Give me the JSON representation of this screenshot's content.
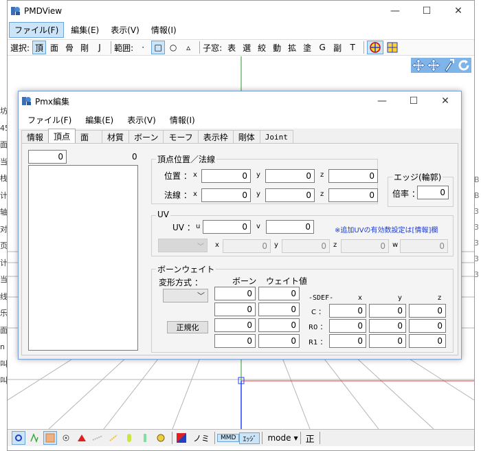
{
  "bg_strip_left": [
    "坊",
    "45",
    "面",
    "当",
    "栈",
    "计",
    "轴",
    "对",
    "页",
    "计",
    "当",
    "线",
    "乐",
    "面",
    "n",
    "叫",
    "叫"
  ],
  "bg_strip_right": [
    "B",
    "B",
    "3",
    "3",
    "3",
    "3",
    "3"
  ],
  "main": {
    "title": "PMDView",
    "menu": [
      "ファイル(F)",
      "編集(E)",
      "表示(V)",
      "情報(I)"
    ],
    "toolbar": {
      "select_label": "選択:",
      "select_buttons": [
        "頂",
        "面",
        "骨",
        "剛",
        "J"
      ],
      "range_label": "範囲:",
      "range_buttons": [
        "·",
        "□",
        "○",
        "▵"
      ],
      "child_label": "子窓:",
      "child_buttons": [
        "表",
        "選",
        "絞",
        "動",
        "拡",
        "塗",
        "G",
        "副",
        "T"
      ]
    },
    "status": {
      "nomi": "ノミ",
      "mmd": "MMD",
      "edge": "ｴｯｼﾞ",
      "mode": "mode",
      "sei": "正"
    }
  },
  "pmx": {
    "title": "Pmx編集",
    "menu": [
      "ファイル(F)",
      "編集(E)",
      "表示(V)",
      "情報(I)"
    ],
    "tabs": [
      "情報",
      "頂点",
      "面",
      "材質",
      "ボーン",
      "モーフ",
      "表示枠",
      "剛体",
      "Joint"
    ],
    "active_tab": "頂点",
    "vertex_index": "0",
    "vertex_count": "0",
    "pos_group": {
      "title": "頂点位置／法線",
      "position_label": "位置 ：",
      "normal_label": "法線 ：",
      "ax": [
        "x",
        "y",
        "z"
      ],
      "position": [
        "0",
        "0",
        "0"
      ],
      "normal": [
        "0",
        "0",
        "0"
      ]
    },
    "edge_group": {
      "title": "エッジ(輪郭)",
      "scale_label": "倍率 ：",
      "scale": "0"
    },
    "uv_group": {
      "title": "UV",
      "uv_label": "UV ：",
      "u_label": "u",
      "v_label": "v",
      "u": "0",
      "v": "0",
      "note": "※追加UVの有効数設定は[情報]欄",
      "ext_labels": [
        "x",
        "y",
        "z",
        "w"
      ],
      "ext": [
        "0",
        "0",
        "0",
        "0"
      ]
    },
    "weight_group": {
      "title": "ボーンウェイト",
      "deform_label": "変形方式 ：",
      "bone_header": "ボーン",
      "weight_header": "ウェイト値",
      "normalize_btn": "正規化",
      "bones": [
        "0",
        "0",
        "0",
        "0"
      ],
      "weights": [
        "0",
        "0",
        "0",
        "0"
      ],
      "sdef": {
        "header": "-SDEF-",
        "cols": [
          "x",
          "y",
          "z"
        ],
        "rows": [
          {
            "label": "C ：",
            "vals": [
              "0",
              "0",
              "0"
            ]
          },
          {
            "label": "R0 ：",
            "vals": [
              "0",
              "0",
              "0"
            ]
          },
          {
            "label": "R1 ：",
            "vals": [
              "0",
              "0",
              "0"
            ]
          }
        ]
      }
    }
  }
}
